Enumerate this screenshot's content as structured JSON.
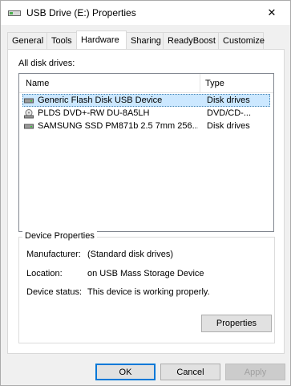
{
  "window": {
    "title": "USB Drive (E:) Properties",
    "close_symbol": "✕"
  },
  "tabs": [
    {
      "label": "General",
      "active": false
    },
    {
      "label": "Tools",
      "active": false
    },
    {
      "label": "Hardware",
      "active": true
    },
    {
      "label": "Sharing",
      "active": false
    },
    {
      "label": "ReadyBoost",
      "active": false
    },
    {
      "label": "Customize",
      "active": false
    }
  ],
  "hardware": {
    "all_disk_drives_label": "All disk drives:",
    "columns": {
      "name": "Name",
      "type": "Type"
    },
    "drives": [
      {
        "name": "Generic Flash Disk USB Device",
        "type": "Disk drives",
        "icon": "disk-drive-icon",
        "selected": true
      },
      {
        "name": "PLDS DVD+-RW DU-8A5LH",
        "type": "DVD/CD-...",
        "icon": "dvd-drive-icon",
        "selected": false
      },
      {
        "name": "SAMSUNG SSD PM871b 2.5 7mm 256...",
        "type": "Disk drives",
        "icon": "disk-drive-icon",
        "selected": false
      }
    ],
    "device_properties": {
      "title": "Device Properties",
      "manufacturer_label": "Manufacturer:",
      "manufacturer_value": "(Standard disk drives)",
      "location_label": "Location:",
      "location_value": "on USB Mass Storage Device",
      "status_label": "Device status:",
      "status_value": "This device is working properly.",
      "properties_button": "Properties"
    }
  },
  "footer": {
    "ok": "OK",
    "cancel": "Cancel",
    "apply": "Apply"
  },
  "colors": {
    "selection": "#cce8ff",
    "accent": "#0078d7"
  }
}
